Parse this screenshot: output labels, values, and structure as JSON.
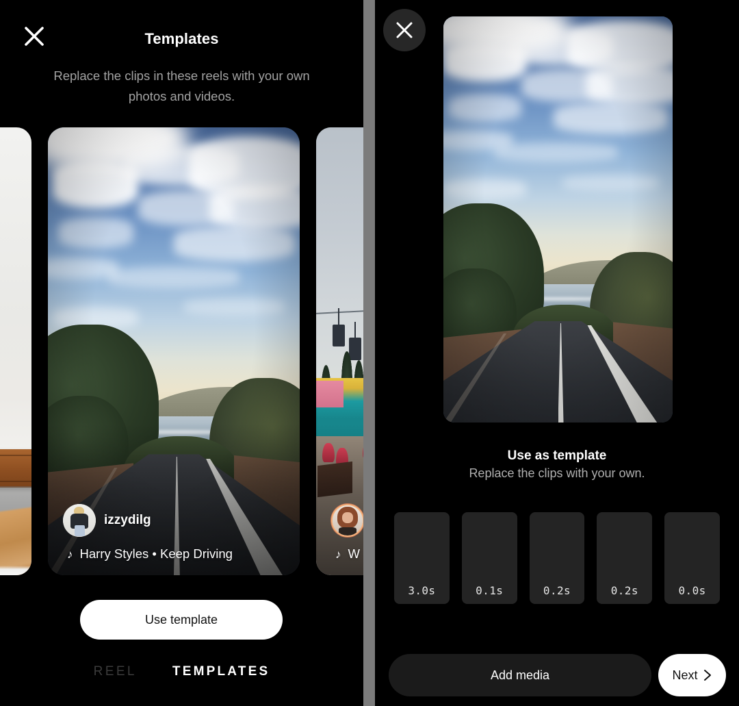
{
  "left_panel": {
    "close_icon": "close-icon",
    "title": "Templates",
    "subtitle": "Replace the clips in these reels with your own photos and videos.",
    "cards": [
      {
        "id": "peek-left",
        "scene": "bright interior with wooden bench and chair",
        "username": "",
        "music": ""
      },
      {
        "id": "main",
        "scene": "blue sky with wispy cirrus clouds over a coastal road",
        "username": "izzydilg",
        "music_icon": "music-note-icon",
        "music": "Harry Styles • Keep Driving"
      },
      {
        "id": "peek-right",
        "scene": "seaside boardwalk with chairlift, palm trees and red benches",
        "username": "",
        "music_icon": "music-note-icon",
        "music": "W"
      }
    ],
    "cta_label": "Use template",
    "tabs": [
      {
        "label": "REEL",
        "active": false
      },
      {
        "label": "TEMPLATES",
        "active": true
      }
    ]
  },
  "right_panel": {
    "close_icon": "close-icon",
    "preview_scene": "coastal road heading toward the ocean under a cloudy blue sky",
    "title": "Use as template",
    "subtitle": "Replace the clips with your own.",
    "clips": [
      {
        "duration": "3.0s"
      },
      {
        "duration": "0.1s"
      },
      {
        "duration": "0.2s"
      },
      {
        "duration": "0.2s"
      },
      {
        "duration": "0.0s"
      }
    ],
    "add_media_label": "Add media",
    "next_label": "Next",
    "next_icon": "chevron-right-icon"
  },
  "colors": {
    "background": "#000000",
    "divider": "#7b7b7b",
    "primary_button": "#ffffff",
    "secondary_button": "#1b1b1b",
    "clip_tile": "#242424",
    "muted_text": "#a3a3a3",
    "inactive_tab": "#3b3b3b"
  }
}
